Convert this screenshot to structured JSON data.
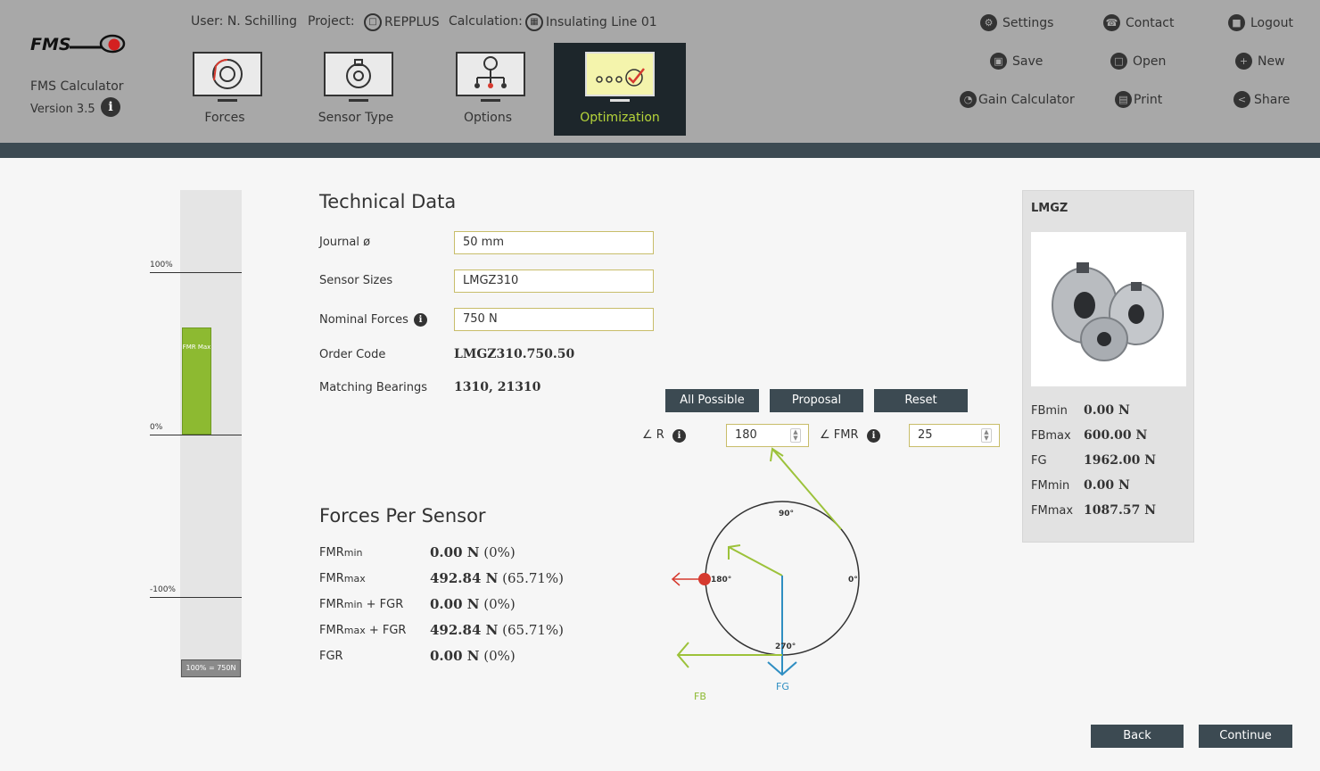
{
  "app": {
    "name": "FMS Calculator",
    "version": "Version 3.5",
    "logo_text": "FMS"
  },
  "topinfo": {
    "user": "User: N. Schilling",
    "project_label": "Project:",
    "project_value": "REPPLUS",
    "calc_label": "Calculation:",
    "calc_value": "Insulating Line 01"
  },
  "tabs": [
    {
      "label": "Forces"
    },
    {
      "label": "Sensor Type"
    },
    {
      "label": "Options"
    },
    {
      "label": "Optimization",
      "active": true
    }
  ],
  "header_buttons": {
    "settings": "Settings",
    "contact": "Contact",
    "logout": "Logout",
    "save": "Save",
    "open": "Open",
    "new": "New",
    "gain": "Gain Calculator",
    "print": "Print",
    "share": "Share"
  },
  "gauge": {
    "top_label": "100%",
    "zero_label": "0%",
    "bottom_label": "-100%",
    "bar_label": "FMR Max",
    "bar_percent": 65.71,
    "scale_label": "100% = 750N"
  },
  "technical": {
    "title": "Technical Data",
    "journal_label": "Journal ø",
    "journal_value": "50 mm",
    "sizes_label": "Sensor Sizes",
    "sizes_value": "LMGZ310",
    "nominal_label": "Nominal Forces",
    "nominal_value": "750 N",
    "order_label": "Order Code",
    "order_value": "LMGZ310.750.50",
    "bearings_label": "Matching Bearings",
    "bearings_value": "1310, 21310"
  },
  "forces": {
    "title": "Forces Per Sensor",
    "rows": [
      {
        "label_main": "FMR",
        "label_sub": "min",
        "label_tail": "",
        "value": "0.00 N",
        "pct": "(0%)"
      },
      {
        "label_main": "FMR",
        "label_sub": "max",
        "label_tail": "",
        "value": "492.84 N",
        "pct": "(65.71%)"
      },
      {
        "label_main": "FMR",
        "label_sub": "min",
        "label_tail": " + FGR",
        "value": "0.00 N",
        "pct": "(0%)"
      },
      {
        "label_main": "FMR",
        "label_sub": "max",
        "label_tail": " + FGR",
        "value": "492.84 N",
        "pct": "(65.71%)"
      },
      {
        "label_main": "FGR",
        "label_sub": "",
        "label_tail": "",
        "value": "0.00 N",
        "pct": "(0%)"
      }
    ]
  },
  "buttons": {
    "all_possible": "All Possible",
    "proposal": "Proposal",
    "reset": "Reset",
    "back": "Back",
    "continue": "Continue"
  },
  "angles": {
    "r_label": "R",
    "r_value": "180",
    "fmr_label": "FMR",
    "fmr_value": "25"
  },
  "diagram": {
    "deg90": "90°",
    "deg0": "0°",
    "deg180": "180°",
    "deg270": "270°",
    "fb": "FB",
    "fg": "FG"
  },
  "product": {
    "title": "LMGZ",
    "specs": [
      {
        "label": "FBmin",
        "value": "0.00 N"
      },
      {
        "label": "FBmax",
        "value": "600.00 N"
      },
      {
        "label": "FG",
        "value": "1962.00 N"
      },
      {
        "label": "FMmin",
        "value": "0.00 N"
      },
      {
        "label": "FMmax",
        "value": "1087.57 N"
      }
    ]
  },
  "colors": {
    "accent_green": "#8dba31",
    "active_tab_text": "#b6d53a",
    "dark": "#3c4a52",
    "red": "#d63a2f",
    "blue": "#2f8ec2"
  }
}
